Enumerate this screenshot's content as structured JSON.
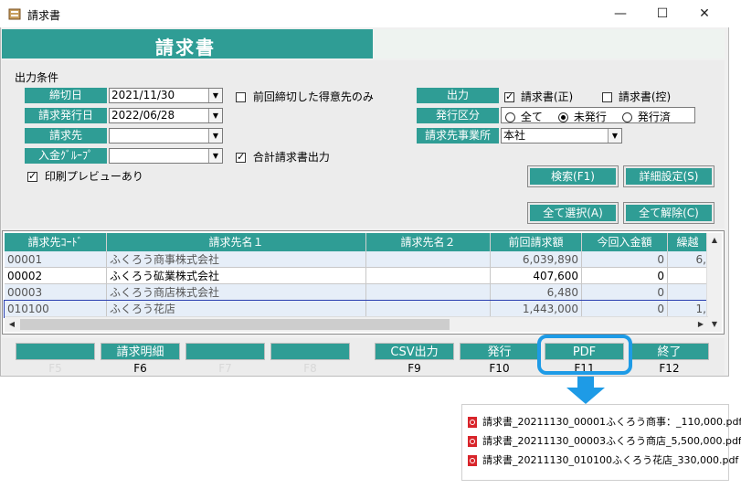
{
  "window": {
    "title": "請求書",
    "minimize": "—",
    "maximize": "☐",
    "close": "✕"
  },
  "header": {
    "title": "請求書"
  },
  "conditions": {
    "section_label": "出力条件",
    "closing_date": {
      "label": "締切日",
      "value": "2021/11/30"
    },
    "issue_date": {
      "label": "請求発行日",
      "value": "2022/06/28"
    },
    "billing_to": {
      "label": "請求先",
      "value": ""
    },
    "deposit_group": {
      "label": "入金ｸﾞﾙｰﾌﾟ",
      "value": ""
    },
    "prev_only": {
      "label": "前回締切した得意先のみ",
      "checked": false
    },
    "total_invoice": {
      "label": "合計請求書出力",
      "checked": true
    },
    "print_preview": {
      "label": "印刷プレビューあり",
      "checked": true
    },
    "output": {
      "label": "出力",
      "opt1": "請求書(正)",
      "opt1_checked": true,
      "opt2": "請求書(控)",
      "opt2_checked": false
    },
    "issue_type": {
      "label": "発行区分",
      "options": [
        "全て",
        "未発行",
        "発行済"
      ],
      "selected": "未発行"
    },
    "office": {
      "label": "請求先事業所",
      "value": "本社"
    },
    "buttons": {
      "search": "検索(F1)",
      "detail": "詳細設定(S)",
      "select_all": "全て選択(A)",
      "clear_all": "全て解除(C)"
    }
  },
  "grid": {
    "columns": [
      "請求先ｺｰﾄﾞ",
      "請求先名１",
      "請求先名２",
      "前回請求額",
      "今回入金額",
      "繰越"
    ],
    "rows": [
      {
        "code": "00001",
        "name1": "ふくろう商事株式会社",
        "name2": "",
        "prev": "6,039,890",
        "deposit": "0",
        "carry": "6,"
      },
      {
        "code": "00002",
        "name1": "ふくろう砿業株式会社",
        "name2": "",
        "prev": "407,600",
        "deposit": "0",
        "carry": ""
      },
      {
        "code": "00003",
        "name1": "ふくろう商店株式会社",
        "name2": "",
        "prev": "6,480",
        "deposit": "0",
        "carry": ""
      },
      {
        "code": "010100",
        "name1": "ふくろう花店",
        "name2": "",
        "prev": "1,443,000",
        "deposit": "0",
        "carry": "1,"
      }
    ]
  },
  "fkeys": [
    {
      "label": "",
      "key": "F5"
    },
    {
      "label": "請求明細",
      "key": "F6"
    },
    {
      "label": "",
      "key": "F7"
    },
    {
      "label": "",
      "key": "F8"
    },
    {
      "label": "CSV出力",
      "key": "F9"
    },
    {
      "label": "発行",
      "key": "F10"
    },
    {
      "label": "PDF",
      "key": "F11"
    },
    {
      "label": "終了",
      "key": "F12"
    }
  ],
  "files": [
    "請求書_20211130_00001ふくろう商事：_110,000.pdf",
    "請求書_20211130_00003ふくろう商店_5,500,000.pdf",
    "請求書_20211130_010100ふくろう花店_330,000.pdf"
  ],
  "colors": {
    "teal": "#2f9d95",
    "highlight": "#1e9be6",
    "pdf_red": "#d8242a"
  }
}
